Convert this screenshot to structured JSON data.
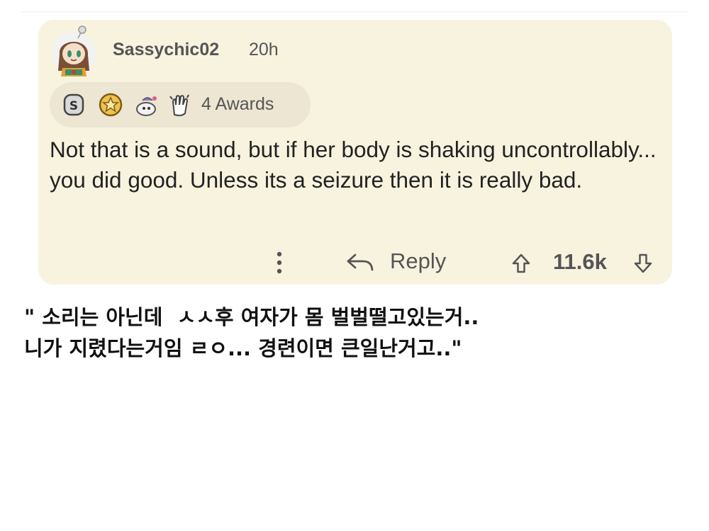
{
  "comment": {
    "username": "Sassychic02",
    "timestamp": "20h",
    "awards": {
      "label": "4 Awards",
      "icons": [
        "silver-coin-icon",
        "gold-star-icon",
        "wholesome-icon",
        "clapping-hands-icon"
      ]
    },
    "body": "Not that is a sound, but if her body is shaking uncontrollably... you did good. Unless its a seizure then it is really bad.",
    "actions": {
      "reply_label": "Reply",
      "vote_count": "11.6k"
    }
  },
  "caption": {
    "line1": "\" 소리는 아닌데  ㅅㅅ후 여자가 몸 벌벌떨고있는거..",
    "line2": "니가 지렸다는거임 ㄹㅇ... 경련이면 큰일난거고..\""
  },
  "colors": {
    "card_background": "#f8f3df",
    "awards_background": "#ece6d2",
    "muted_text": "#555555",
    "body_text": "#222222"
  }
}
